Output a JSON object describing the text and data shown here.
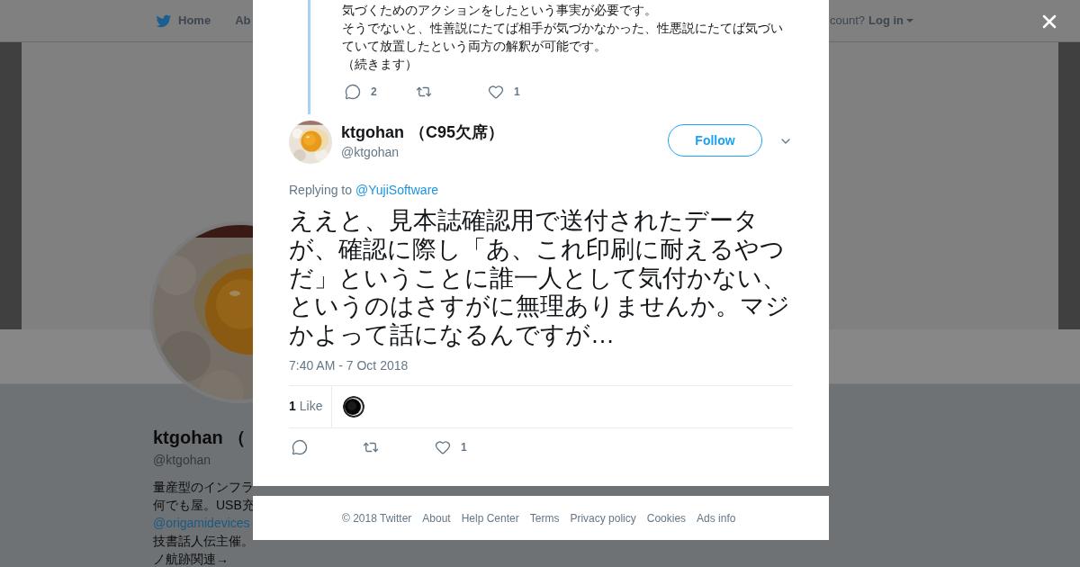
{
  "background_page": {
    "nav": [
      {
        "label": "Home",
        "kind": "home"
      },
      {
        "label": "Ab",
        "kind": "plain"
      }
    ],
    "account_prompt": "count?",
    "login": "Log in",
    "profile": {
      "name": "ktgohan （",
      "handle": "@ktgohan",
      "bio": [
        {
          "kind": "text",
          "text": "量産型のインフラ"
        },
        {
          "kind": "text",
          "text": "何でも屋。USB充"
        },
        {
          "kind": "link",
          "text": "@origamidevices"
        },
        {
          "kind": "text",
          "text": "技書話人伝主催。"
        },
        {
          "kind": "text",
          "text": "ノ航跡関連→"
        }
      ]
    }
  },
  "modal": {
    "previous_tweet": {
      "lines": [
        "気づくためのアクションをしたという事実が必要です。",
        "そうでないと、性善説にたてば相手が気づかなかった、性悪説にたてば気づいていて放置したという両方の解釈が可能です。",
        "（続きます）"
      ],
      "actions": [
        {
          "kind": "reply",
          "count": "2"
        },
        {
          "kind": "retweet"
        },
        {
          "kind": "like",
          "count": "1"
        }
      ]
    },
    "tweet": {
      "name": "ktgohan",
      "name_suffix": "（C95欠席）",
      "handle": "@ktgohan",
      "follow": "Follow",
      "replying_label": "Replying to",
      "replying_to": "@YujiSoftware",
      "text": "ええと、見本誌確認用で送付されたデータが、確認に際し「あ、これ印刷に耐えるやつだ」ということに誰一人として気付かない、というのはさすがに無理ありませんか。マジかよって話になるんですが…",
      "timestamp": "7:40 AM - 7 Oct 2018",
      "likes_count": "1",
      "likes_label": "Like",
      "actions": [
        {
          "kind": "reply"
        },
        {
          "kind": "retweet"
        },
        {
          "kind": "like",
          "count": "1"
        }
      ]
    }
  },
  "footer": {
    "copyright": "© 2018 Twitter",
    "links": [
      "About",
      "Help Center",
      "Terms",
      "Privacy policy",
      "Cookies",
      "Ads info"
    ]
  }
}
